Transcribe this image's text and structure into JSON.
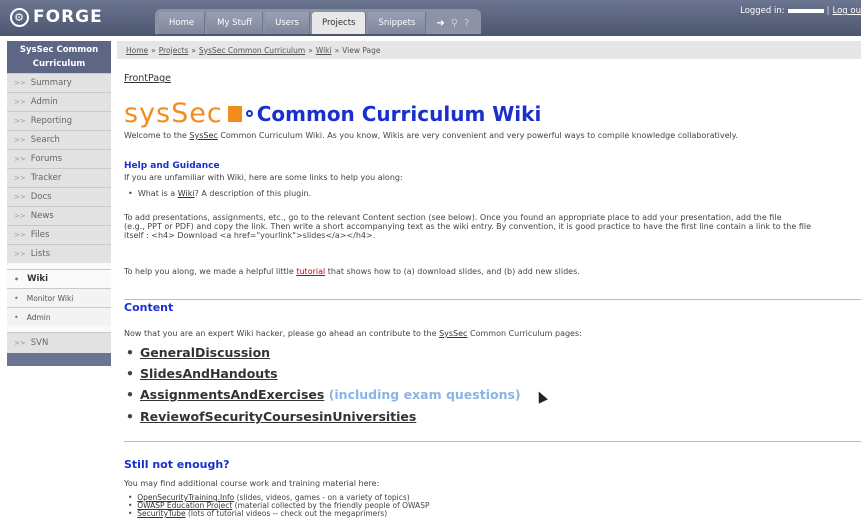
{
  "brand": {
    "name": "FORGE"
  },
  "tabs": [
    "Home",
    "My Stuff",
    "Users",
    "Projects",
    "Snippets"
  ],
  "login": {
    "label": "Logged in:",
    "separator": "|",
    "logout": "Log ou"
  },
  "sidebar": {
    "project": "SysSec Common Curriculum",
    "items": [
      "Summary",
      "Admin",
      "Reporting",
      "Search",
      "Forums",
      "Tracker",
      "Docs",
      "News",
      "Files",
      "Lists"
    ],
    "wiki_items": [
      "Wiki",
      "Monitor Wiki",
      "Admin"
    ],
    "bottom_items": [
      "SVN"
    ]
  },
  "breadcrumb": {
    "items": [
      "Home",
      "Projects",
      "SysSec Common Curriculum",
      "Wiki"
    ],
    "current": "View Page",
    "sep": "»"
  },
  "page": {
    "frontpage": "FrontPage",
    "logo_text": "sysSec",
    "title": "Common Curriculum Wiki",
    "welcome_pre": "Welcome to the ",
    "welcome_link": "SysSec",
    "welcome_post": " Common Curriculum Wiki. As you know, Wikis are very convenient and very powerful ways to compile knowledge collaboratively.",
    "help_heading": "Help and Guidance",
    "help_intro": "If you are unfamiliar with Wiki, here are some links to help you along:",
    "help_item_pre": "What is a ",
    "help_item_link": "Wiki",
    "help_item_post": "? A description of this plugin.",
    "add_line1": "To add presentations, assignments, etc., go to the relevant Content section (see below). Once you found an appropriate place to add your presentation, add the file",
    "add_line2": "(e.g., PPT or PDF) and copy the link. Then write a short accompanying text as the wiki entry. By convention, it is good practice to have the first line contain a link to the file",
    "add_line3": "itself : <h4> Download <a href=\"yourlink\">slides</a></h4>.",
    "tutorial_pre": "To help you along, we made a helpful little ",
    "tutorial_link": "tutorial",
    "tutorial_post": " that shows how to (a) download slides, and (b) add new slides.",
    "content_heading": "Content",
    "content_intro_pre": "Now that you are an expert Wiki hacker, please go ahead an contribute to the ",
    "content_intro_link": "SysSec",
    "content_intro_post": " Common Curriculum pages:",
    "content_links": [
      "GeneralDiscussion",
      "SlidesAndHandouts",
      "AssignmentsAndExercises",
      "ReviewofSecurityCoursesinUniversities"
    ],
    "exam_note": "(including exam questions)",
    "more_heading": "Still not enough?",
    "more_intro": "You may find additional course work and training material here:",
    "more_items": [
      {
        "link": "OpenSecurityTraining.Info",
        "text": " (slides, videos, games - on a variety of topics)"
      },
      {
        "link": "OWASP Education Project",
        "text": " (material collected by the friendly people of OWASP"
      },
      {
        "link": "SecurityTube",
        "text": " (lots of tutorial videos -- check out the megaprimers)"
      }
    ]
  },
  "icons": [
    "gear-icon",
    "login-arrow-icon",
    "search-icon",
    "help-icon",
    "pointer-cursor-icon"
  ]
}
